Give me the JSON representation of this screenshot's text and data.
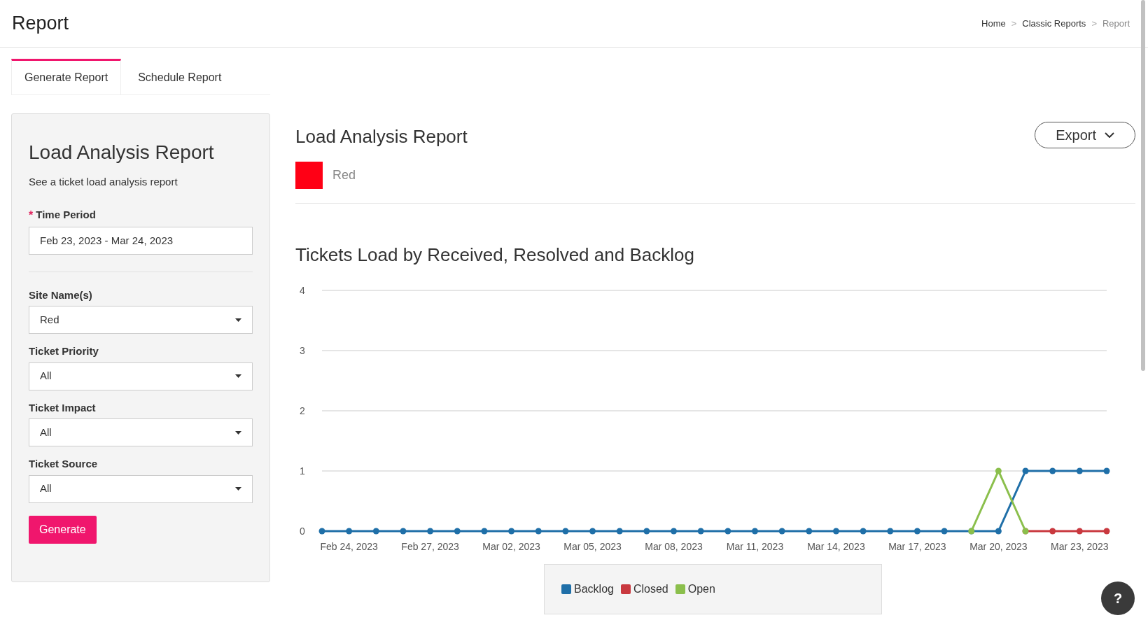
{
  "header": {
    "title": "Report",
    "breadcrumb": [
      {
        "label": "Home",
        "current": false
      },
      {
        "label": "Classic Reports",
        "current": false
      },
      {
        "label": "Report",
        "current": true
      }
    ],
    "separator": ">"
  },
  "tabs": [
    {
      "label": "Generate Report",
      "selected": true
    },
    {
      "label": "Schedule Report",
      "selected": false
    }
  ],
  "form": {
    "title": "Load Analysis Report",
    "subtitle": "See a ticket load analysis report",
    "fields": [
      {
        "kind": "text",
        "label": "Time Period",
        "required": true,
        "value": "Feb 23, 2023 - Mar 24, 2023"
      },
      {
        "kind": "select",
        "label": "Site Name(s)",
        "required": false,
        "value": "Red"
      },
      {
        "kind": "select",
        "label": "Ticket Priority",
        "required": false,
        "value": "All"
      },
      {
        "kind": "select",
        "label": "Ticket Impact",
        "required": false,
        "value": "All"
      },
      {
        "kind": "select",
        "label": "Ticket Source",
        "required": false,
        "value": "All"
      }
    ],
    "required_mark": "*",
    "button": "Generate"
  },
  "report": {
    "title": "Load Analysis Report",
    "site": {
      "label": "Red",
      "color": "#ff0015"
    },
    "export": "Export",
    "chart_title": "Tickets Load by Received, Resolved and Backlog",
    "chart_data": {
      "type": "line",
      "categories": [
        null,
        "Feb 24, 2023",
        null,
        null,
        "Feb 27, 2023",
        null,
        null,
        "Mar 02, 2023",
        null,
        null,
        "Mar 05, 2023",
        null,
        null,
        "Mar 08, 2023",
        null,
        null,
        "Mar 11, 2023",
        null,
        null,
        "Mar 14, 2023",
        null,
        null,
        "Mar 17, 2023",
        null,
        null,
        "Mar 20, 2023",
        null,
        null,
        "Mar 23, 2023",
        null
      ],
      "yticks": [
        0,
        1,
        2,
        3,
        4
      ],
      "ylim": [
        0,
        4
      ],
      "grid": true,
      "series": [
        {
          "name": "Backlog",
          "color": "#1f6fa8",
          "marker": "circle",
          "values": [
            0,
            0,
            0,
            0,
            0,
            0,
            0,
            0,
            0,
            0,
            0,
            0,
            0,
            0,
            0,
            0,
            0,
            0,
            0,
            0,
            0,
            0,
            0,
            0,
            0,
            0,
            1,
            1,
            1,
            1
          ]
        },
        {
          "name": "Closed",
          "color": "#c9393f",
          "marker": "circle",
          "values": [
            null,
            null,
            null,
            null,
            null,
            null,
            null,
            null,
            null,
            null,
            null,
            null,
            null,
            null,
            null,
            null,
            null,
            null,
            null,
            null,
            null,
            null,
            null,
            null,
            null,
            null,
            0,
            0,
            0,
            0
          ]
        },
        {
          "name": "Open",
          "color": "#8bbf4c",
          "marker": "circle",
          "values": [
            null,
            null,
            null,
            null,
            null,
            null,
            null,
            null,
            null,
            null,
            null,
            null,
            null,
            null,
            null,
            null,
            null,
            null,
            null,
            null,
            null,
            null,
            null,
            null,
            0,
            1,
            0,
            null,
            null,
            null
          ]
        }
      ]
    }
  },
  "help_button": "?"
}
